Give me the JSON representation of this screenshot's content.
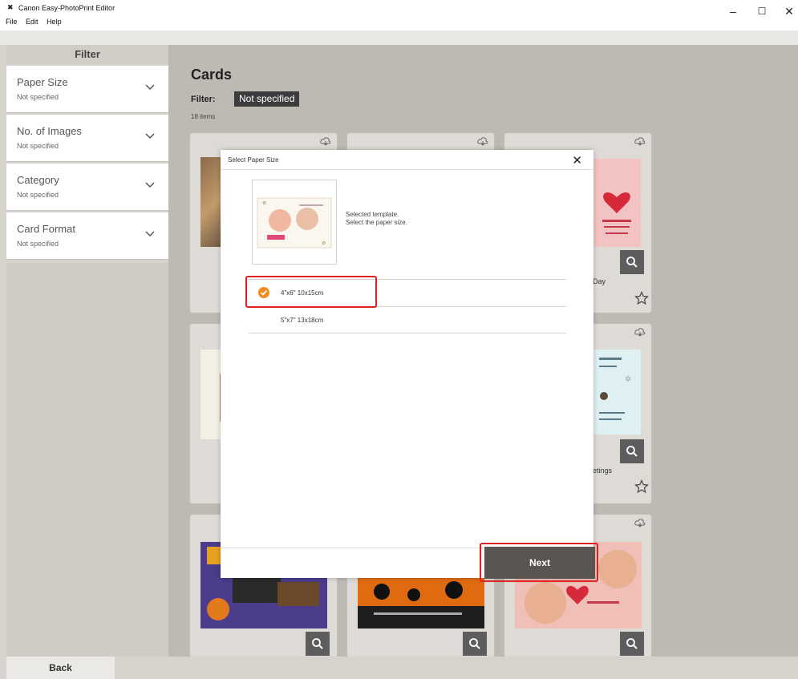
{
  "window": {
    "app_logo": "✖",
    "title": "Canon Easy-PhotoPrint Editor",
    "minimize": "–",
    "maximize": "☐",
    "close": "✕"
  },
  "menu": [
    "File",
    "Edit",
    "Help"
  ],
  "sidebar": {
    "header": "Filter",
    "items": [
      {
        "label": "Paper Size",
        "value": "Not specified"
      },
      {
        "label": "No. of Images",
        "value": "Not specified"
      },
      {
        "label": "Category",
        "value": "Not specified"
      },
      {
        "label": "Card Format",
        "value": "Not specified"
      }
    ]
  },
  "main": {
    "title": "Cards",
    "filter_label": "Filter:",
    "filter_value": "Not specified",
    "items_count": "18 items"
  },
  "cards": [
    {
      "name": "Day"
    },
    {
      "name": "etings"
    }
  ],
  "dialog": {
    "title": "Select Paper Size",
    "close": "✕",
    "message_line1": "Selected template.",
    "message_line2": "Select the paper size.",
    "sizes": [
      "4\"x6\" 10x15cm",
      "5\"x7\" 13x18cm"
    ],
    "selected_index": 0,
    "next_label": "Next"
  },
  "footer": {
    "back_label": "Back"
  },
  "colors": {
    "accent_orange": "#f08c1e",
    "highlight_red": "#e02020",
    "button_dark": "#5a5550"
  }
}
